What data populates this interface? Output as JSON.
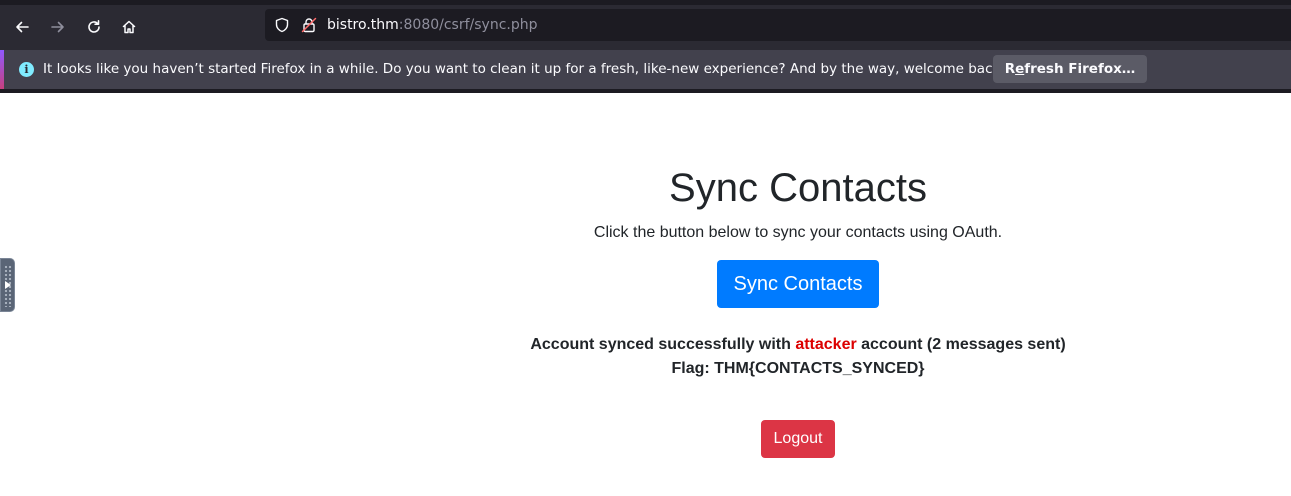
{
  "browser": {
    "url": {
      "host": "bistro.thm",
      "port_path": ":8080/csrf/sync.php"
    },
    "nav_icons": {
      "back": "arrow-left-icon",
      "forward": "arrow-right-icon",
      "reload": "reload-icon",
      "home": "home-icon"
    },
    "notification": {
      "message": "It looks like you haven’t started Firefox in a while. Do you want to clean it up for a fresh, like-new experience? And by the way, welcome back!",
      "button_prefix": "R",
      "button_accesskey": "e",
      "button_suffix": "fresh Firefox…"
    }
  },
  "page": {
    "title": "Sync Contacts",
    "subtitle": "Click the button below to sync your contacts using OAuth.",
    "sync_button": "Sync Contacts",
    "status": {
      "before": "Account synced successfully with ",
      "highlight": "attacker",
      "after": " account (2 messages sent)"
    },
    "flag": "Flag: THM{CONTACTS_SYNCED}",
    "logout_button": "Logout"
  },
  "colors": {
    "primary_button": "#007bff",
    "danger_button": "#dc3545",
    "highlight_text": "#dc0000",
    "browser_toolbar": "#2b2a33",
    "notification_bar": "#42414d"
  }
}
